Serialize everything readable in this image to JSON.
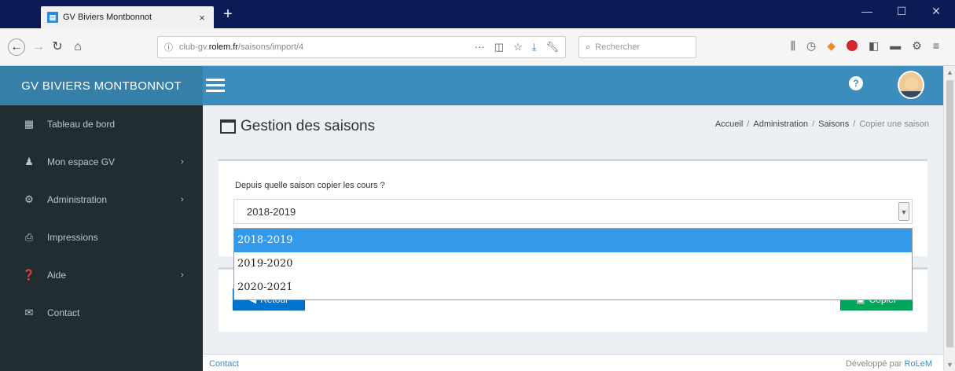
{
  "browser": {
    "tab_title": "GV Biviers Montbonnot",
    "tab_close": "×",
    "new_tab": "+",
    "url_info": "ⓘ",
    "url_prefix": "club-gv.",
    "url_host": "rolem.fr",
    "url_path": "/saisons/import/4",
    "url_more": "···",
    "search_placeholder": "Rechercher",
    "window_controls": [
      "—",
      "☐",
      "✕"
    ]
  },
  "app": {
    "brand": "GV BIVIERS MONTBONNOT",
    "help_icon": "?"
  },
  "sidebar": {
    "items": [
      {
        "label": "Tableau de bord",
        "icon": "table-icon",
        "glyph": "▦",
        "chevron": ""
      },
      {
        "label": "Mon espace GV",
        "icon": "user-icon",
        "glyph": "♟",
        "chevron": "›"
      },
      {
        "label": "Administration",
        "icon": "cogs-icon",
        "glyph": "⚙",
        "chevron": "›"
      },
      {
        "label": "Impressions",
        "icon": "print-icon",
        "glyph": "⎙",
        "chevron": ""
      },
      {
        "label": "Aide",
        "icon": "question-icon",
        "glyph": "❓",
        "chevron": "›"
      },
      {
        "label": "Contact",
        "icon": "envelope-icon",
        "glyph": "✉",
        "chevron": ""
      }
    ]
  },
  "page": {
    "title": "Gestion des saisons",
    "breadcrumb": [
      "Accueil",
      "Administration",
      "Saisons",
      "Copier une saison"
    ],
    "breadcrumb_sep": "/"
  },
  "form": {
    "label": "Depuis quelle saison copier les cours ?",
    "selected": "2018-2019",
    "options": [
      "2018-2019",
      "2019-2020",
      "2020-2021"
    ],
    "back_label": "Retour",
    "copy_label": "Copier"
  },
  "footer": {
    "contact": "Contact",
    "credit_prefix": "Développé par ",
    "credit_link": "RoLeM"
  },
  "colors": {
    "header": "#3c8dbc",
    "sidebar": "#222d32",
    "back_button": "#0075d0",
    "copy_button": "#00a65a",
    "selected_option": "#3399ea"
  }
}
